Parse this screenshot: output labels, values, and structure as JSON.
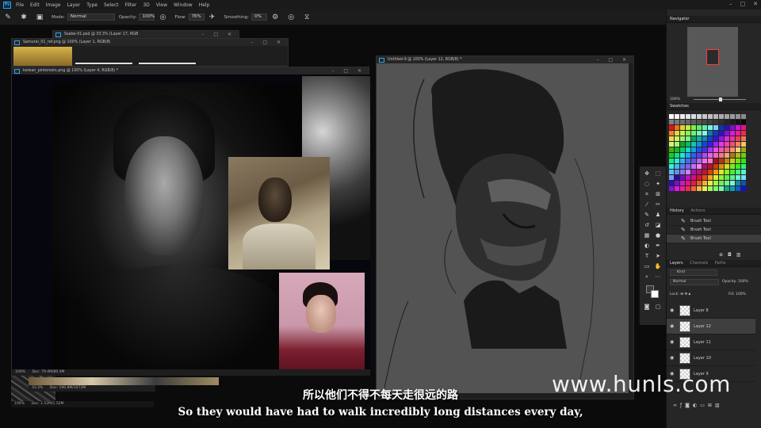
{
  "menu": {
    "logo": "Ps",
    "items": [
      "File",
      "Edit",
      "Image",
      "Layer",
      "Type",
      "Select",
      "Filter",
      "3D",
      "View",
      "Window",
      "Help"
    ],
    "window_controls": [
      "–",
      "□",
      "✕"
    ]
  },
  "options_bar": {
    "mode_label": "Mode:",
    "mode_value": "Normal",
    "opacity_label": "Opacity:",
    "opacity_value": "100%",
    "flow_label": "Flow:",
    "flow_value": "76%",
    "smoothing_label": "Smoothing:",
    "smoothing_value": "0%"
  },
  "documents": {
    "bg1_title": "Ssabe-01.psd @ 33.3% (Layer 17, RGB",
    "bg2_title": "Samurai_01_ref.png @ 100% (Layer 1, RGB/8)",
    "ref_title": "korean_pinterests.png @ 100% (Layer 4, RGB/8) *",
    "ref_zoom": "100%",
    "ref_doc": "Doc: 79.4M/80.4M",
    "ref2_zoom": "33.3%",
    "ref2_doc": "Doc: 190.8M/1073M",
    "ref3_zoom": "100%",
    "ref3_doc": "Doc: 1.52M/1.52M",
    "canvas_title": "Untitled-9 @ 100% (Layer 12, RGB/8) *"
  },
  "panels": {
    "navigator_tab": "Navigator",
    "navigator_zoom": "100%",
    "swatches_tab": "Swatches",
    "history_tabs": [
      "History",
      "Actions"
    ],
    "history_items": [
      "Brush Tool",
      "Brush Tool",
      "Brush Tool"
    ],
    "layers_tabs": [
      "Layers",
      "Channels",
      "Paths"
    ],
    "kind_label": "Kind",
    "blend_mode": "Normal",
    "opacity_label": "Opacity:",
    "opacity_value": "100%",
    "lock_label": "Lock:",
    "fill_label": "Fill:",
    "fill_value": "100%",
    "layers": [
      "Layer 8",
      "Layer 12",
      "Layer 11",
      "Layer 10",
      "Layer 9"
    ]
  },
  "subtitles": {
    "chinese": "所以他们不得不每天走很远的路",
    "english": "So they would have had to walk incredibly long distances every day,"
  },
  "watermark": "www.hunls.com",
  "colors": {
    "accent": "#2aa4f4",
    "panel_bg": "#262626",
    "canvas_gray": "#535353"
  }
}
